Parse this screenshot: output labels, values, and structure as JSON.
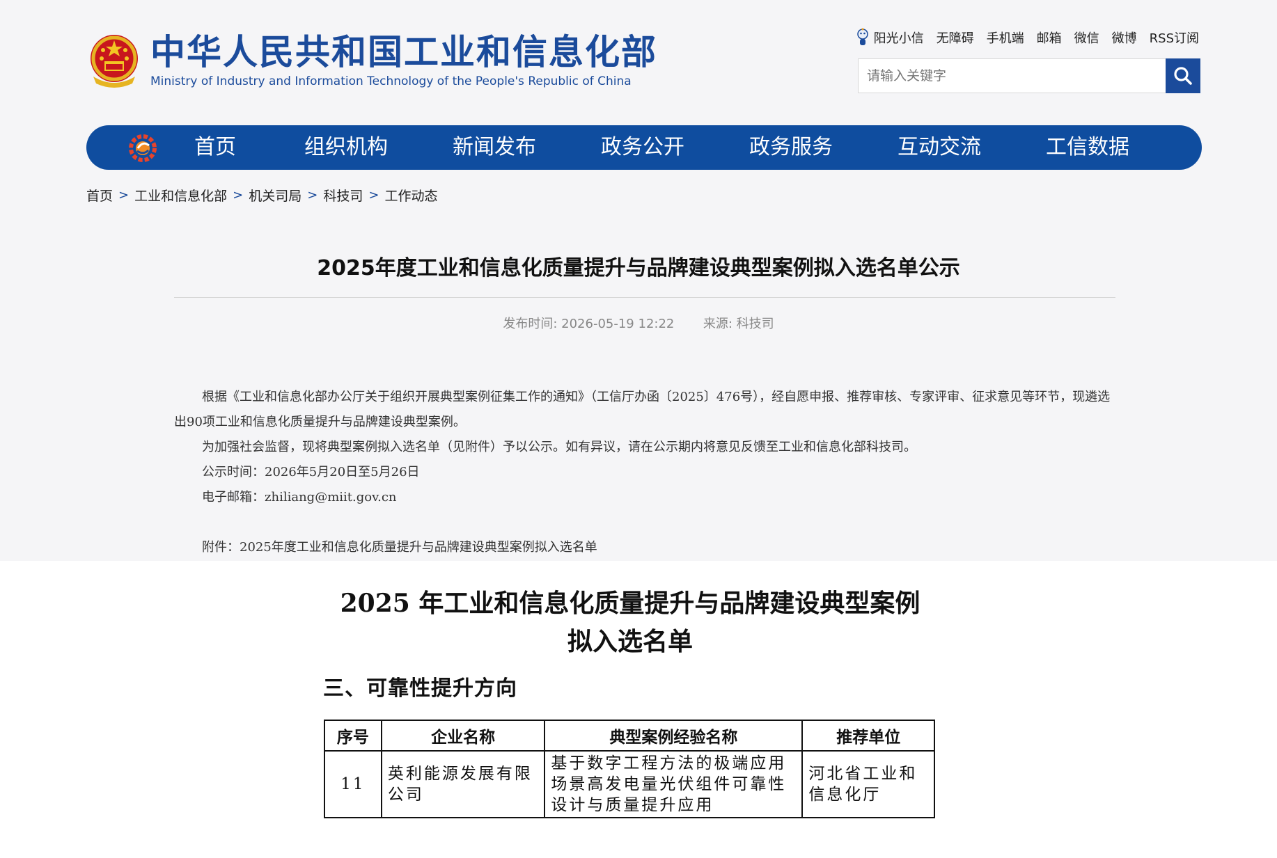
{
  "header": {
    "title_cn": "中华人民共和国工业和信息化部",
    "title_en": "Ministry of Industry and Information Technology of the People's Republic of China",
    "top_links": [
      "阳光小信",
      "无障碍",
      "手机端",
      "邮箱",
      "微信",
      "微博",
      "RSS订阅"
    ],
    "search_placeholder": "请输入关键字"
  },
  "nav": {
    "items": [
      "首页",
      "组织机构",
      "新闻发布",
      "政务公开",
      "政务服务",
      "互动交流",
      "工信数据"
    ]
  },
  "breadcrumb": [
    "首页",
    "工业和信息化部",
    "机关司局",
    "科技司",
    "工作动态"
  ],
  "article": {
    "title": "2025年度工业和信息化质量提升与品牌建设典型案例拟入选名单公示",
    "publish_label": "发布时间:",
    "publish_time": "2026-05-19 12:22",
    "source_label": "来源:",
    "source": "科技司",
    "paragraphs": [
      "根据《工业和信息化部办公厅关于组织开展典型案例征集工作的通知》（工信厅办函〔2025〕476号），经自愿申报、推荐审核、专家评审、征求意见等环节，现遴选出90项工业和信息化质量提升与品牌建设典型案例。",
      "为加强社会监督，现将典型案例拟入选名单（见附件）予以公示。如有异议，请在公示期内将意见反馈至工业和信息化部科技司。",
      "公示时间：2026年5月20日至5月26日",
      "电子邮箱：zhiliang@miit.gov.cn"
    ],
    "attachment": "附件：2025年度工业和信息化质量提升与品牌建设典型案例拟入选名单"
  },
  "attachment_doc": {
    "title_line1": "2025 年工业和信息化质量提升与品牌建设典型案例",
    "title_line2": "拟入选名单",
    "section": "三、可靠性提升方向",
    "columns": [
      "序号",
      "企业名称",
      "典型案例经验名称",
      "推荐单位"
    ],
    "rows": [
      {
        "no": "11",
        "company": "英利能源发展有限公司",
        "case": "基于数字工程方法的极端应用场景高发电量光伏组件可靠性设计与质量提升应用",
        "unit": "河北省工业和信息化厅"
      }
    ]
  }
}
